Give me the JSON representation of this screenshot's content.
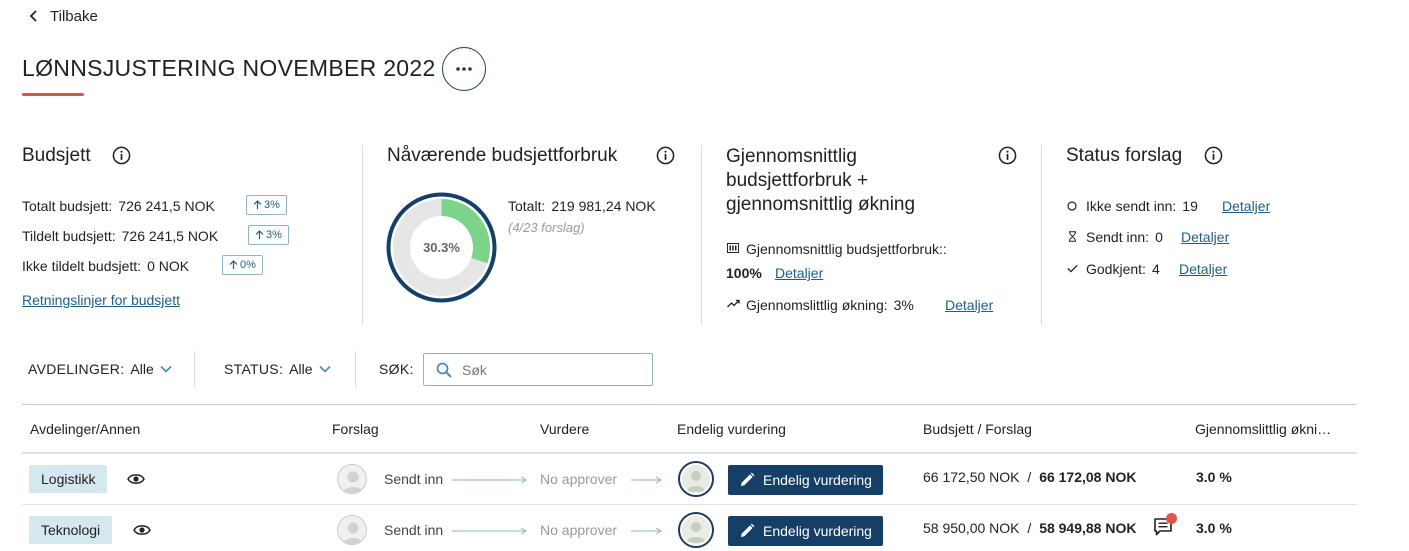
{
  "nav": {
    "back_label": "Tilbake"
  },
  "page": {
    "title": "LØNNSJUSTERING NOVEMBER 2022"
  },
  "budget": {
    "title": "Budsjett",
    "total_label": "Totalt budsjett:",
    "total_value": "726 241,5 NOK",
    "total_badge": "3%",
    "assigned_label": "Tildelt budsjett:",
    "assigned_value": "726 241,5 NOK",
    "assigned_badge": "3%",
    "unassigned_label": "Ikke tildelt budsjett:",
    "unassigned_value": "0 NOK",
    "unassigned_badge": "0%",
    "guidelines_link": "Retningslinjer for budsjett"
  },
  "current_usage": {
    "title": "Nåværende budsjettforbruk",
    "donut_label": "30.3%",
    "donut_fraction": 0.303,
    "total_label": "Totalt:",
    "total_value": "219 981,24 NOK",
    "proposals_note": "(4/23 forslag)"
  },
  "average": {
    "title_line1": "Gjennomsnittlig",
    "title_line2": "budsjettforbruk +",
    "title_line3": "gjennomsnittlig økning",
    "usage_label": "Gjennomsnittlig budsjettforbruk::",
    "usage_value": "100%",
    "increase_label": "Gjennomslittlig økning:",
    "increase_value": "3%",
    "details_link": "Detaljer"
  },
  "proposal_status": {
    "title": "Status forslag",
    "items": [
      {
        "label": "Ikke sendt inn:",
        "count": "19",
        "link": "Detaljer"
      },
      {
        "label": "Sendt inn:",
        "count": "0",
        "link": "Detaljer"
      },
      {
        "label": "Godkjent:",
        "count": "4",
        "link": "Detaljer"
      }
    ]
  },
  "filters": {
    "departments_key": "AVDELINGER:",
    "departments_value": "Alle",
    "status_key": "STATUS:",
    "status_value": "Alle",
    "search_key": "SØK:",
    "search_placeholder": "Søk"
  },
  "table": {
    "headers": [
      "Avdelinger/Annen",
      "Forslag",
      "Vurdere",
      "Endelig vurdering",
      "Budsjett / Forslag",
      "Gjennomslittlig økni…"
    ],
    "rows": [
      {
        "department": "Logistikk",
        "proposal_status": "Sendt inn",
        "assess": "No approver",
        "final_button": "Endelig vurdering",
        "budget": "66 172,50 NOK",
        "sep": "/",
        "proposal": "66 172,08 NOK",
        "avg_increase": "3.0 %"
      },
      {
        "department": "Teknologi",
        "proposal_status": "Sendt inn",
        "assess": "No approver",
        "final_button": "Endelig vurdering",
        "budget": "58 950,00 NOK",
        "sep": "/",
        "proposal": "58 949,88 NOK",
        "avg_increase": "3.0 %",
        "has_comment": true
      }
    ]
  },
  "colors": {
    "accent_red": "#d9534f",
    "navy": "#153f66",
    "donut_fill": "#7dd38a",
    "donut_track": "#e6e6e6",
    "chip_bg": "#d5e7ef",
    "notification_dot": "#e0534f"
  }
}
